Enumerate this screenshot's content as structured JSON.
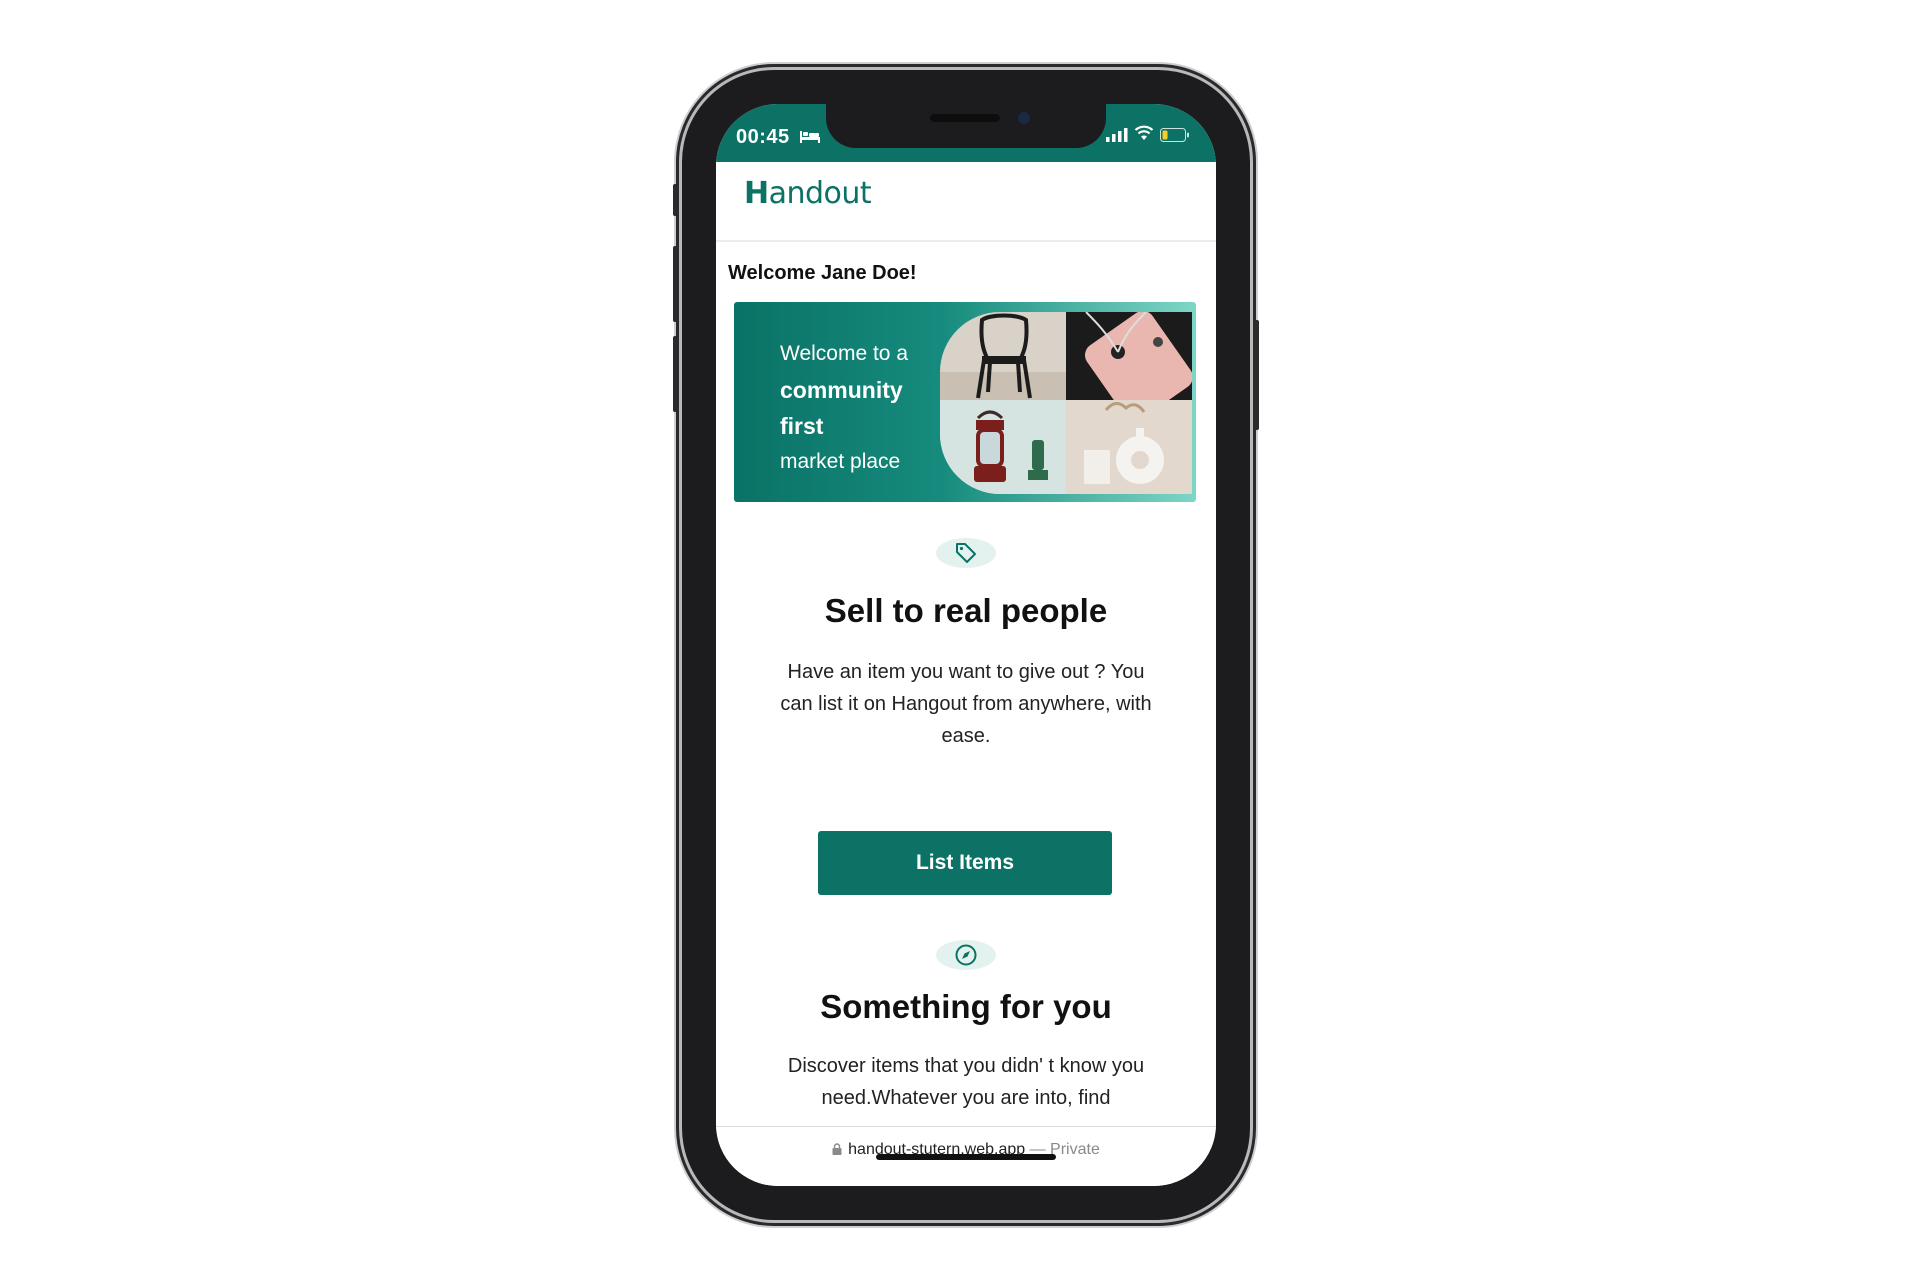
{
  "status_bar": {
    "time": "00:45"
  },
  "app": {
    "logo_first": "H",
    "logo_rest": "andout"
  },
  "greeting": "Welcome Jane Doe!",
  "hero": {
    "line1": "Welcome to a",
    "line2": "community",
    "line3": "first",
    "line4": "market place"
  },
  "sell": {
    "title": "Sell to real people",
    "description": "Have an item you want to give out ? You can list it on Hangout from anywhere, with ease.",
    "button_label": "List Items"
  },
  "discover": {
    "title": "Something for you",
    "description": "Discover items that you didn' t know you need.Whatever you are into, find"
  },
  "browser": {
    "url": "handout-stutern.web.app",
    "separator": " — ",
    "mode": "Private"
  },
  "colors": {
    "brand": "#0c7266",
    "icon_bg": "#e3f2ef",
    "text": "#111111"
  },
  "icons": [
    "bed-icon",
    "signal-icon",
    "wifi-icon",
    "battery-icon",
    "tag-icon",
    "compass-icon",
    "lock-icon"
  ]
}
